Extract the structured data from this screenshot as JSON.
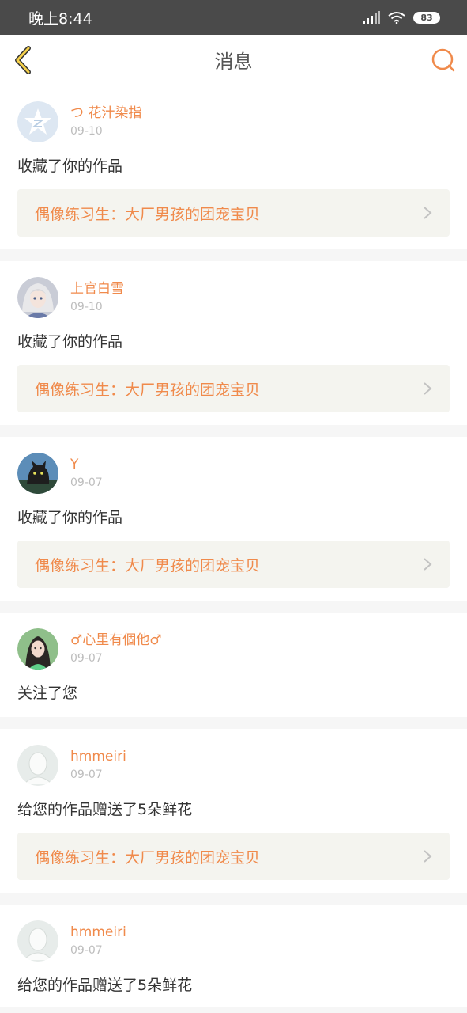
{
  "status": {
    "time": "晚上8:44",
    "battery": "83"
  },
  "header": {
    "title": "消息"
  },
  "messages": [
    {
      "name": "つ 花汁染指",
      "date": "09-10",
      "action": "收藏了你的作品",
      "work": "偶像练习生：大厂男孩的团宠宝贝"
    },
    {
      "name": "上官白雪",
      "date": "09-10",
      "action": "收藏了你的作品",
      "work": "偶像练习生：大厂男孩的团宠宝贝"
    },
    {
      "name": "Y",
      "date": "09-07",
      "action": "收藏了你的作品",
      "work": "偶像练习生：大厂男孩的团宠宝贝"
    },
    {
      "name": "♂心里有個他♂",
      "date": "09-07",
      "action": "关注了您"
    },
    {
      "name": "hmmeiri",
      "date": "09-07",
      "action": "给您的作品赠送了5朵鲜花",
      "work": "偶像练习生：大厂男孩的团宠宝贝"
    },
    {
      "name": "hmmeiri",
      "date": "09-07",
      "action": "给您的作品赠送了5朵鲜花"
    }
  ],
  "colors": {
    "accent": "#f08a4b",
    "statusbar": "#4a4a4a",
    "card_bg": "#f4f4ef"
  },
  "icons": [
    "back-chevron-icon",
    "search-icon",
    "signal-icon",
    "wifi-icon",
    "battery-icon",
    "chevron-right-icon",
    "qzone-star-icon",
    "anime-girl-avatar",
    "cat-avatar",
    "photo-avatar",
    "default-person-avatar"
  ]
}
